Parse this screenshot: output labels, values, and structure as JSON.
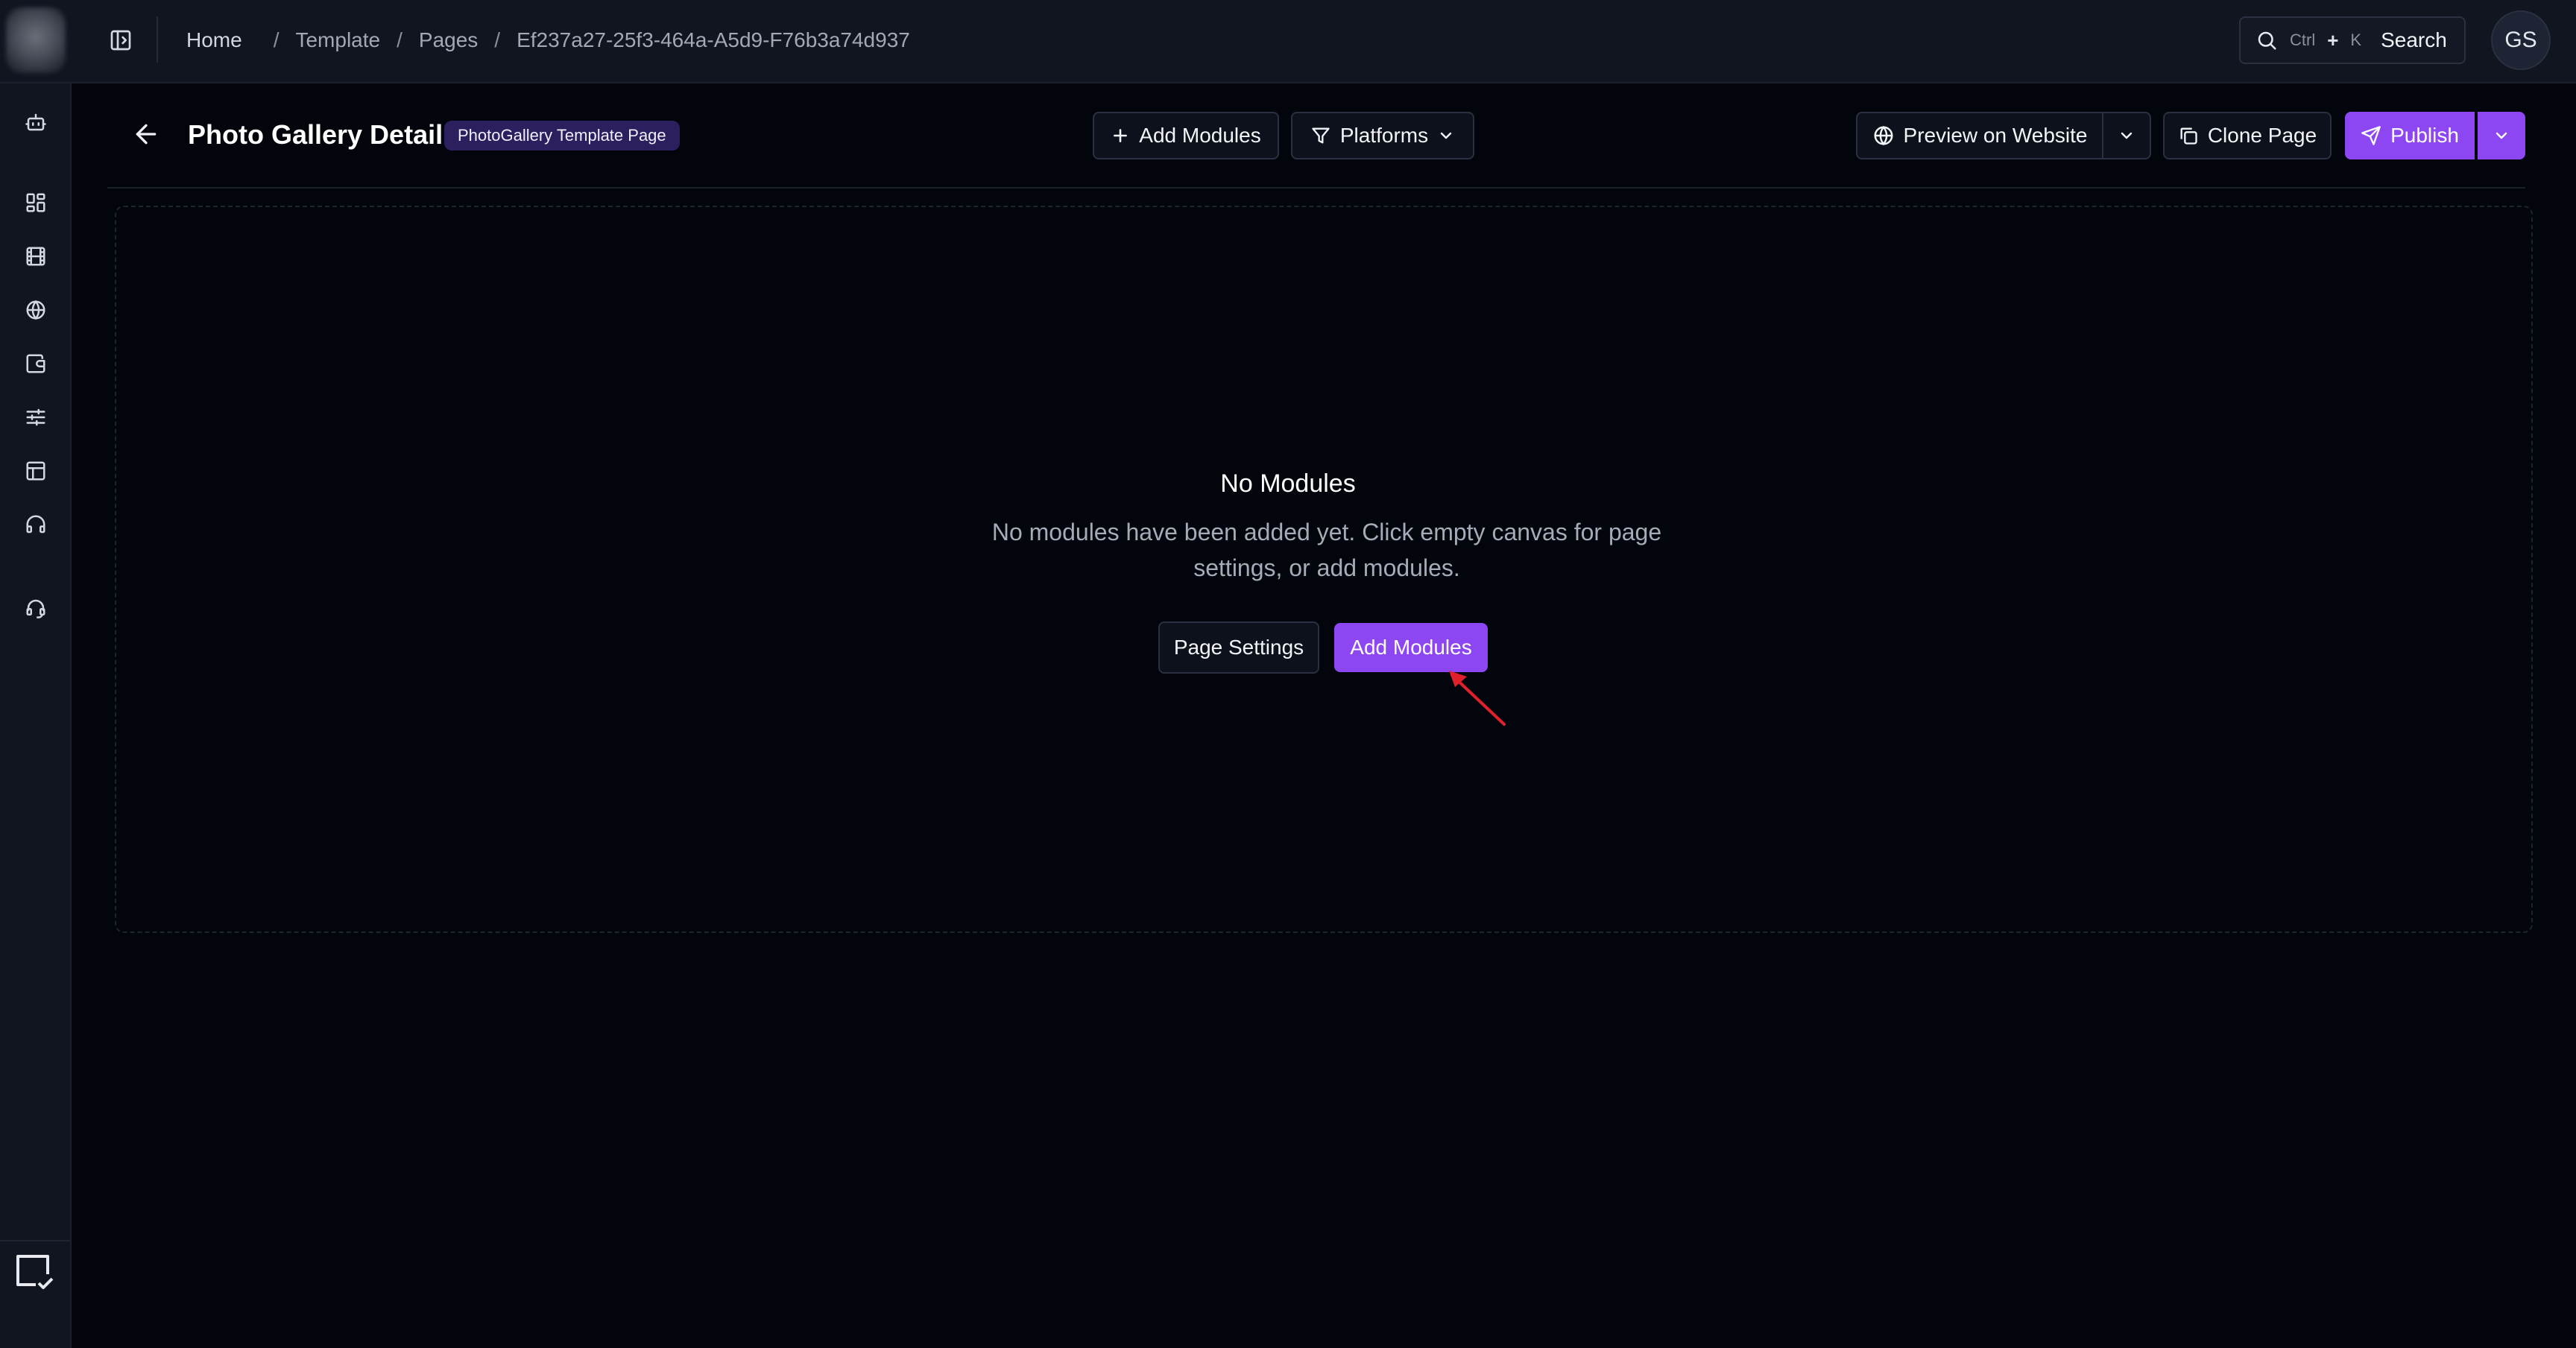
{
  "breadcrumbs": {
    "home": "Home",
    "template": "Template",
    "pages": "Pages",
    "current": "Ef237a27-25f3-464a-A5d9-F76b3a74d937",
    "separator": "/"
  },
  "search": {
    "kbd_ctrl": "Ctrl",
    "kbd_plus": "+",
    "kbd_k": "K",
    "label": "Search"
  },
  "user": {
    "initials": "GS"
  },
  "header": {
    "title": "Photo Gallery Detail",
    "tag": "PhotoGallery Template Page",
    "add_modules_label": "Add Modules",
    "platforms_label": "Platforms",
    "preview_label": "Preview on Website",
    "clone_label": "Clone Page",
    "publish_label": "Publish"
  },
  "empty_state": {
    "title": "No Modules",
    "description": "No modules have been added yet. Click empty canvas for page settings, or add modules.",
    "page_settings_label": "Page Settings",
    "add_modules_label": "Add Modules"
  },
  "rail_icons": [
    "robot-icon",
    "dashboard-icon",
    "film-icon",
    "globe-icon",
    "wallet-icon",
    "sliders-icon",
    "layout-icon",
    "headphones-icon",
    "headset-icon"
  ],
  "colors": {
    "accent": "#8d47f2",
    "background": "#03050d",
    "surface": "#111520",
    "tag_bg": "#2b1f5e",
    "annotation_arrow": "#e0202a"
  }
}
